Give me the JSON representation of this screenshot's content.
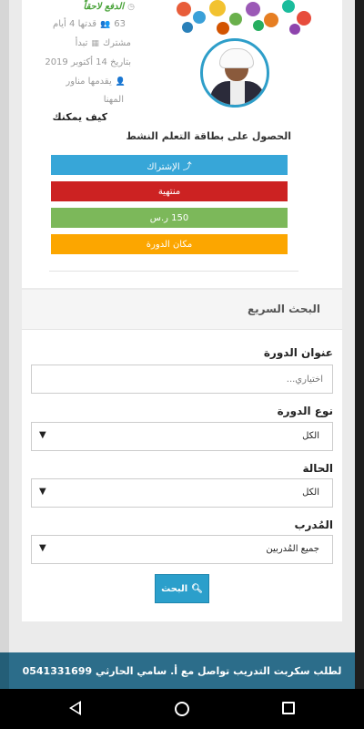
{
  "course": {
    "payment_later": "الدفع لاحقاً",
    "duration_count": "63",
    "duration_text": "قدتها 4 أيام",
    "participants_text": "مشترك",
    "starts_text": "تبدأ",
    "date_text": "بتاريخ 14 أكتوبر 2019",
    "presenter_text": "يقدمها مناور",
    "presenter_extra": "المهنا",
    "how_text": "كيف يمكنك",
    "certificate_text": "الحصول على بطاقة التعلم النشط",
    "buttons": [
      {
        "label": "⤴ الإشتراك",
        "color": "#37a6d8"
      },
      {
        "label": "منتهية",
        "color": "#cc2222"
      },
      {
        "label": "150 ر.س",
        "color": "#7cb85a"
      },
      {
        "label": "مكان الدورة",
        "color": "#fca600"
      }
    ]
  },
  "search": {
    "title": "البحث السريع",
    "course_title_label": "عنوان الدورة",
    "course_title_placeholder": "اختياري...",
    "course_type_label": "نوع الدورة",
    "course_type_value": "الكل",
    "status_label": "الحالة",
    "status_value": "الكل",
    "trainer_label": "المُدرب",
    "trainer_value": "جميع المُدربين",
    "submit_label": "البحث"
  },
  "footer": {
    "text": "لطلب سكربت التدريب تواصل مع أ. سامي الحارثي 0541331699"
  }
}
